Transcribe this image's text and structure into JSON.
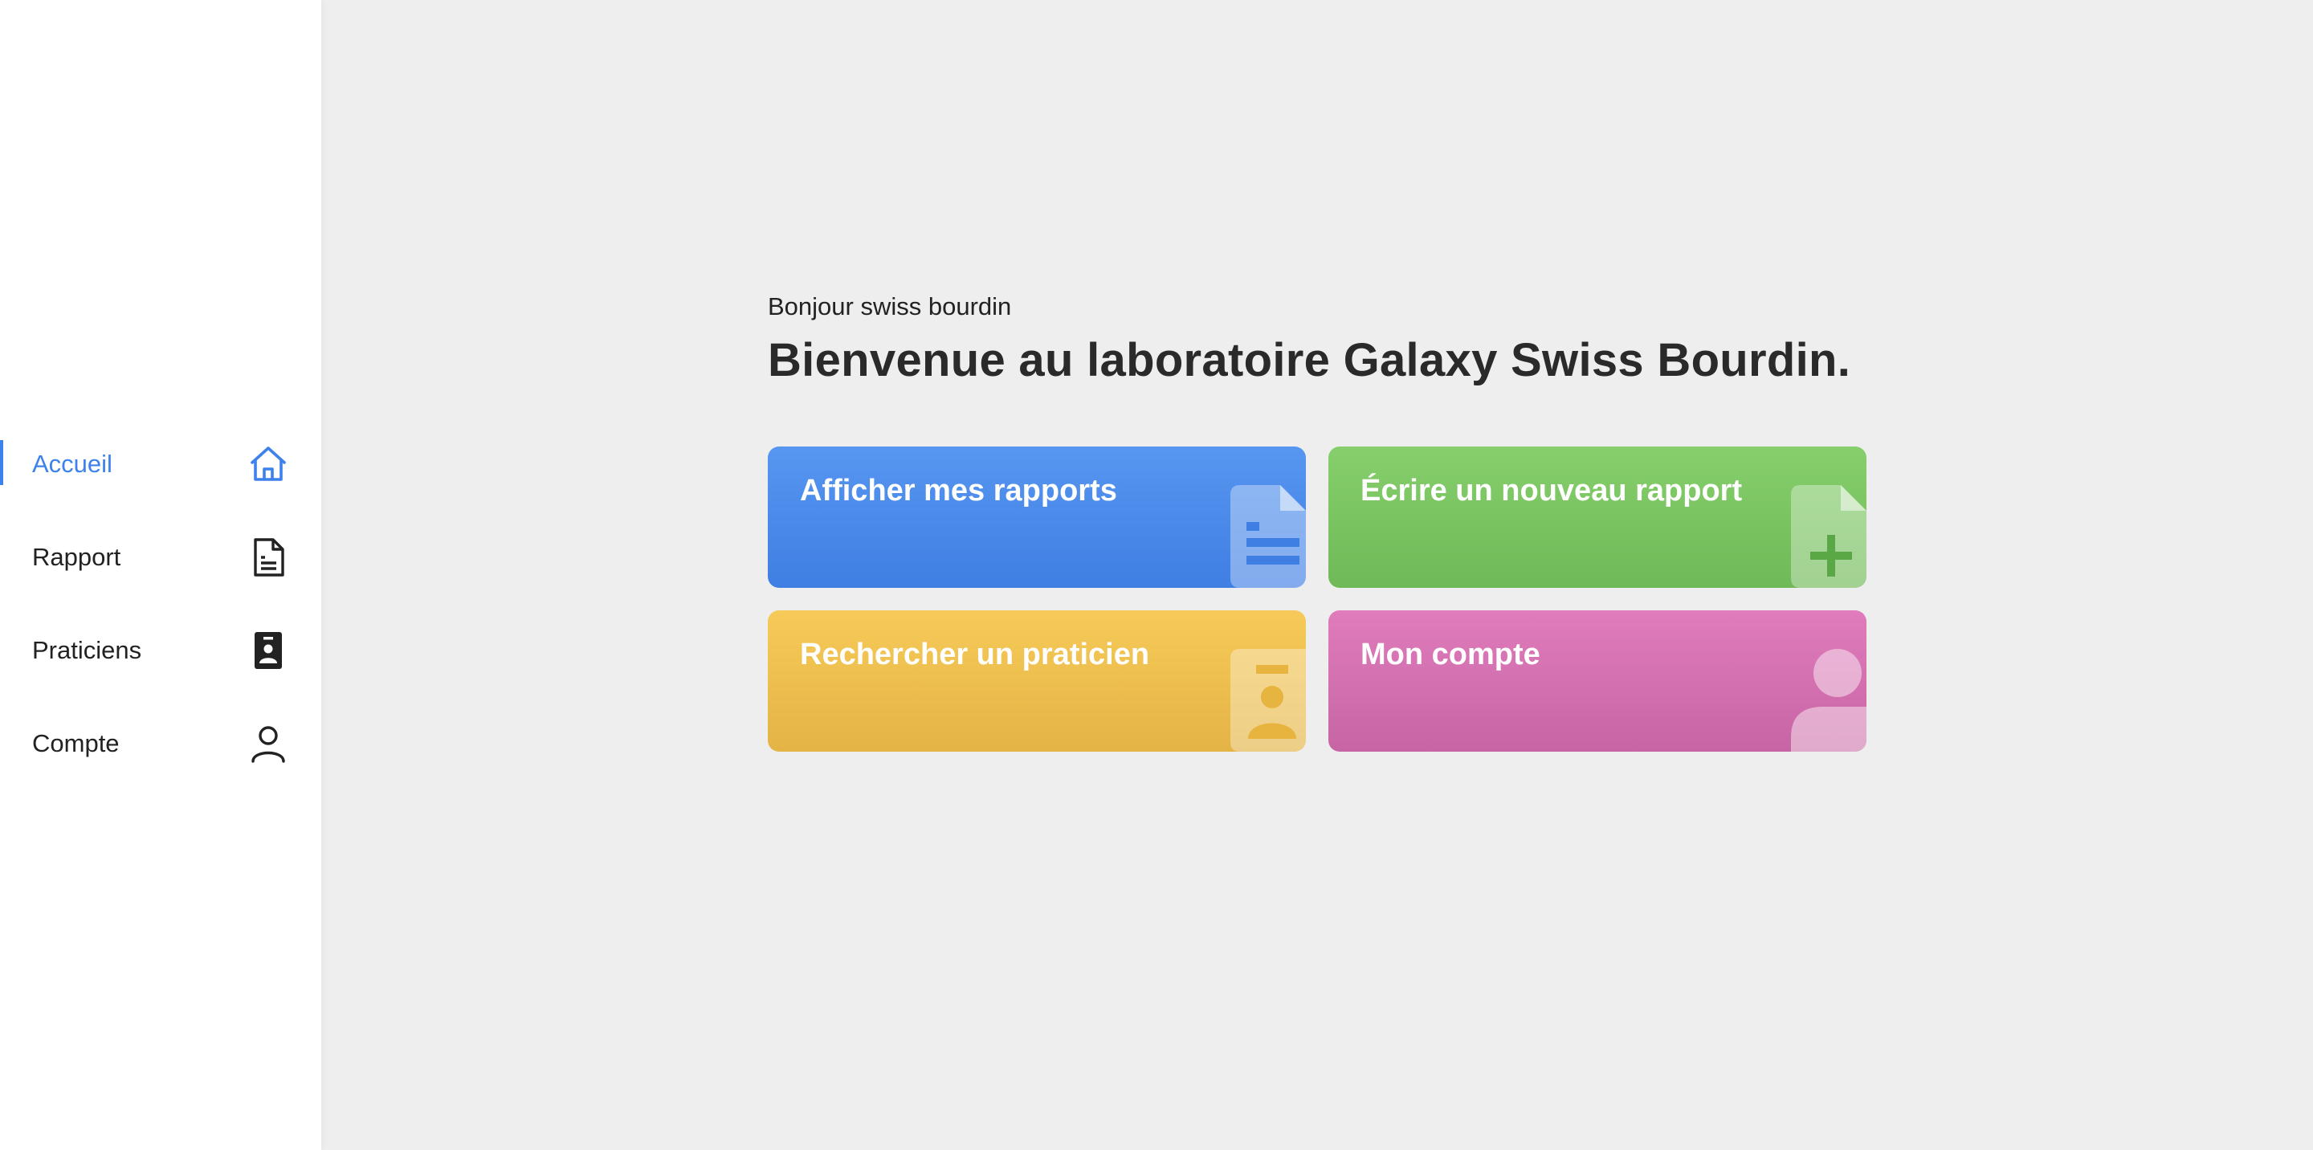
{
  "sidebar": {
    "items": [
      {
        "label": "Accueil",
        "icon": "home-icon",
        "active": true
      },
      {
        "label": "Rapport",
        "icon": "document-icon",
        "active": false
      },
      {
        "label": "Praticiens",
        "icon": "contact-card-icon",
        "active": false
      },
      {
        "label": "Compte",
        "icon": "user-icon",
        "active": false
      }
    ]
  },
  "main": {
    "greeting": "Bonjour swiss bourdin",
    "headline": "Bienvenue au laboratoire Galaxy Swiss Bourdin.",
    "cards": [
      {
        "title": "Afficher mes rapports",
        "icon": "document-icon",
        "color": "#4a89ea"
      },
      {
        "title": "Écrire un nouveau rapport",
        "icon": "document-add-icon",
        "color": "#7cc462"
      },
      {
        "title": "Rechercher un praticien",
        "icon": "contact-card-icon",
        "color": "#f0c04f"
      },
      {
        "title": "Mon compte",
        "icon": "user-icon",
        "color": "#d672b2"
      }
    ]
  },
  "colors": {
    "accent": "#3d82ec",
    "background": "#eeeeef",
    "sidebar": "#ffffff"
  }
}
